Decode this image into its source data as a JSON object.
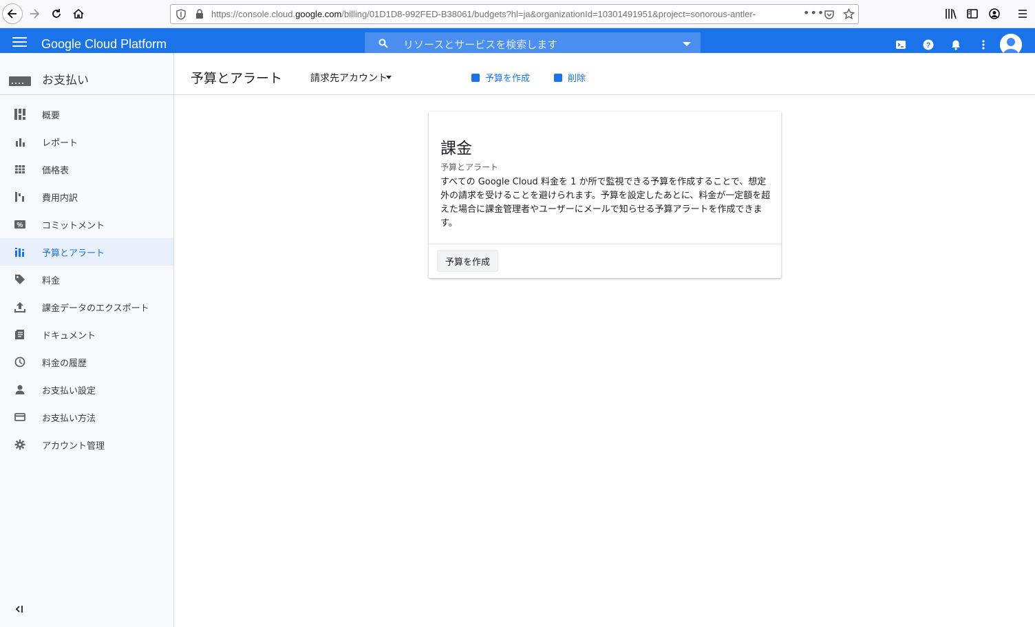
{
  "browser": {
    "url_prefix": "https://console.cloud.",
    "url_domain": "google.com",
    "url_suffix": "/billing/01D1D8-992FED-B38061/budgets?hl=ja&organizationId=10301491951&project=sonorous-antler-",
    "more_label": "•••"
  },
  "header": {
    "title": "Google Cloud Platform",
    "search_placeholder": "リソースとサービスを検索します",
    "accent_color": "#1a73e8"
  },
  "sidebar": {
    "section_title": "お支払い",
    "items": [
      {
        "label": "概要",
        "icon": "dashboard-icon"
      },
      {
        "label": "レポート",
        "icon": "bar-chart-icon"
      },
      {
        "label": "価格表",
        "icon": "table-icon"
      },
      {
        "label": "費用内訳",
        "icon": "waterfall-icon"
      },
      {
        "label": "コミットメント",
        "icon": "percent-icon"
      },
      {
        "label": "予算とアラート",
        "icon": "budget-icon",
        "active": true
      },
      {
        "label": "料金",
        "icon": "tag-icon"
      },
      {
        "label": "課金データのエクスポート",
        "icon": "upload-icon"
      },
      {
        "label": "ドキュメント",
        "icon": "document-icon"
      },
      {
        "label": "料金の履歴",
        "icon": "clock-icon"
      },
      {
        "label": "お支払い設定",
        "icon": "person-icon"
      },
      {
        "label": "お支払い方法",
        "icon": "credit-card-icon"
      },
      {
        "label": "アカウント管理",
        "icon": "gear-icon"
      }
    ]
  },
  "toolbar": {
    "title": "予算とアラート",
    "account_label": "請求先アカウント",
    "create_label": "予算を作成",
    "delete_label": "削除"
  },
  "card": {
    "title": "課金",
    "subtitle": "予算とアラート",
    "body": "すべての Google Cloud 料金を 1 か所で監視できる予算を作成することで、想定外の請求を受けることを避けられます。予算を設定したあとに、料金が一定額を超えた場合に課金管理者やユーザーにメールで知らせる予算アラートを作成できます。",
    "button_label": "予算を作成"
  }
}
